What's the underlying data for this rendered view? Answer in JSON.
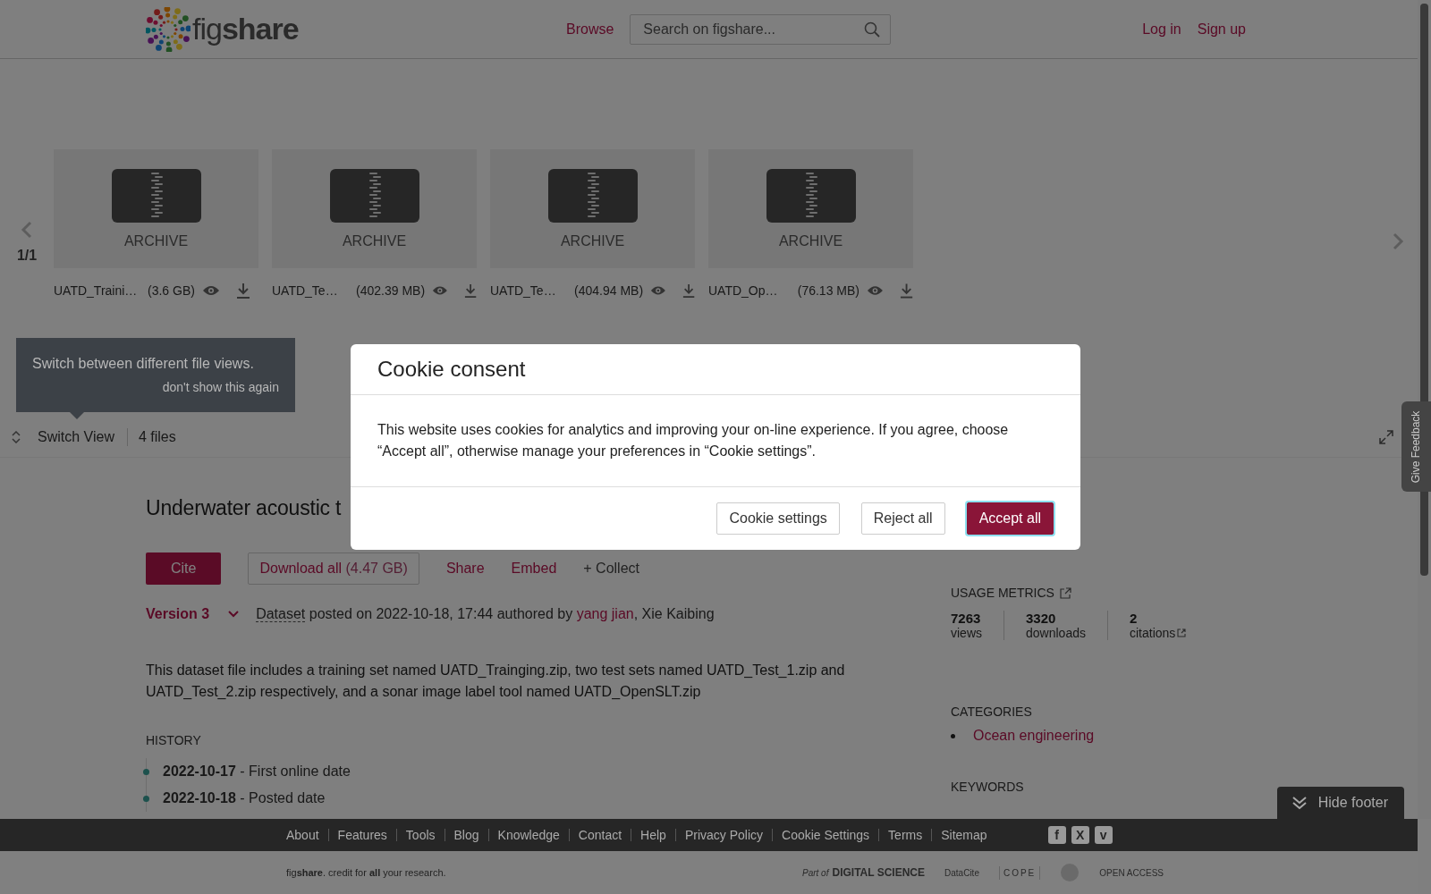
{
  "header": {
    "logo": "fig**share**",
    "browse": "Browse",
    "search": {
      "placeholder": "Search on figshare..."
    },
    "auth": [
      "Log in",
      "Sign up"
    ]
  },
  "viewer": {
    "page_indicator": "1/1",
    "files": [
      {
        "type_label": "ARCHIVE",
        "name": "UATD_Traini…",
        "size": "(3.6 GB)"
      },
      {
        "type_label": "ARCHIVE",
        "name": "UATD_Te…",
        "size": "(402.39 MB)"
      },
      {
        "type_label": "ARCHIVE",
        "name": "UATD_Te…",
        "size": "(404.94 MB)"
      },
      {
        "type_label": "ARCHIVE",
        "name": "UATD_Op…",
        "size": "(76.13 MB)"
      }
    ],
    "tooltip": {
      "text": "Switch between different file views.",
      "dismiss": "don't show this again"
    },
    "switch_view": "Switch View",
    "file_count": "4 files"
  },
  "article": {
    "title": "Underwater acoustic t",
    "actions": [
      {
        "label": "Cite",
        "kind": "primary"
      },
      {
        "label": "Download all",
        "size": "(4.47 GB)",
        "kind": "outline"
      },
      {
        "label": "Share",
        "kind": "link"
      },
      {
        "label": "Embed",
        "kind": "link"
      },
      {
        "label": "+ Collect",
        "kind": "muted"
      }
    ],
    "version": "Version 3",
    "meta": [
      {
        "text": "Dataset",
        "kind": "abbr"
      },
      {
        "text": " posted on 2022-10-18, 17:44 authored by ",
        "kind": "plain"
      },
      {
        "text": "yang jian",
        "kind": "link"
      },
      {
        "text": ", Xie Kaibing",
        "kind": "plain"
      }
    ],
    "description": "This dataset file includes a training set named UATD_Trainging.zip, two test sets named UATD_Test_1.zip and UATD_Test_2.zip respectively, and a sonar image label tool named UATD_OpenSLT.zip",
    "history_heading": "HISTORY",
    "history": [
      "**2022-10-17** - First online date",
      "**2022-10-18** - Posted date"
    ]
  },
  "sidebar": {
    "metrics_heading": "USAGE METRICS",
    "metrics": [
      {
        "value": "7263",
        "label": "views",
        "external": false
      },
      {
        "value": "3320",
        "label": "downloads",
        "external": false
      },
      {
        "value": "2",
        "label": "citations",
        "external": true
      }
    ],
    "categories_heading": "CATEGORIES",
    "categories": [
      "Ocean engineering"
    ],
    "keywords_heading": "KEYWORDS"
  },
  "feedback": "Give Feedback",
  "hide_footer": "Hide footer",
  "footer": {
    "links": [
      "About",
      "Features",
      "Tools",
      "Blog",
      "Knowledge",
      "Contact",
      "Help",
      "Privacy Policy",
      "Cookie Settings",
      "Terms",
      "Sitemap"
    ],
    "social": [
      "f",
      "X",
      "v"
    ],
    "tagline": "fig**share**. credit for **all** your research.",
    "partners": [
      "Part of",
      "DIGITAL SCIENCE",
      "DataCite",
      "COPE",
      "OPEN ACCESS"
    ]
  },
  "dialog": {
    "title": "Cookie consent",
    "body": "This website uses cookies for analytics and improving your on-line experience. If you agree, choose “Accept all”, otherwise manage your preferences in “Cookie settings”.",
    "buttons": [
      {
        "label": "Cookie settings",
        "kind": "secondary"
      },
      {
        "label": "Reject all",
        "kind": "secondary"
      },
      {
        "label": "Accept all",
        "kind": "primary"
      }
    ]
  }
}
